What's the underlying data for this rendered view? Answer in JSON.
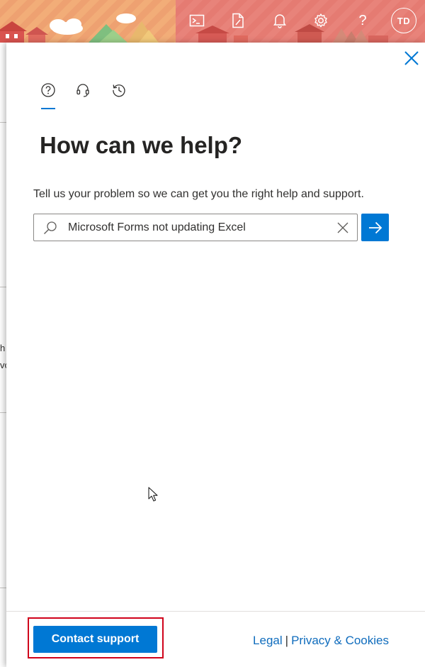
{
  "topbar": {
    "icons": [
      "cloud-shell-icon",
      "document-edit-icon",
      "bell-icon",
      "gear-icon",
      "help-icon"
    ],
    "help_glyph": "?",
    "avatar_initials": "TD"
  },
  "left_fragment": {
    "text_line1": "h",
    "text_line2": "vo"
  },
  "panel": {
    "tabs": [
      "help-circle-icon",
      "headset-icon",
      "history-icon"
    ],
    "active_tab": 0,
    "heading": "How can we help?",
    "subtext": "Tell us your problem so we can get you the right help and support.",
    "search": {
      "value": "Microsoft Forms not updating Excel",
      "placeholder": ""
    },
    "footer": {
      "contact_label": "Contact support",
      "legal_label": "Legal",
      "separator": "|",
      "privacy_label": "Privacy & Cookies"
    }
  },
  "colors": {
    "accent": "#0078d4",
    "link": "#0f6cbd",
    "highlight": "#d0021b"
  }
}
